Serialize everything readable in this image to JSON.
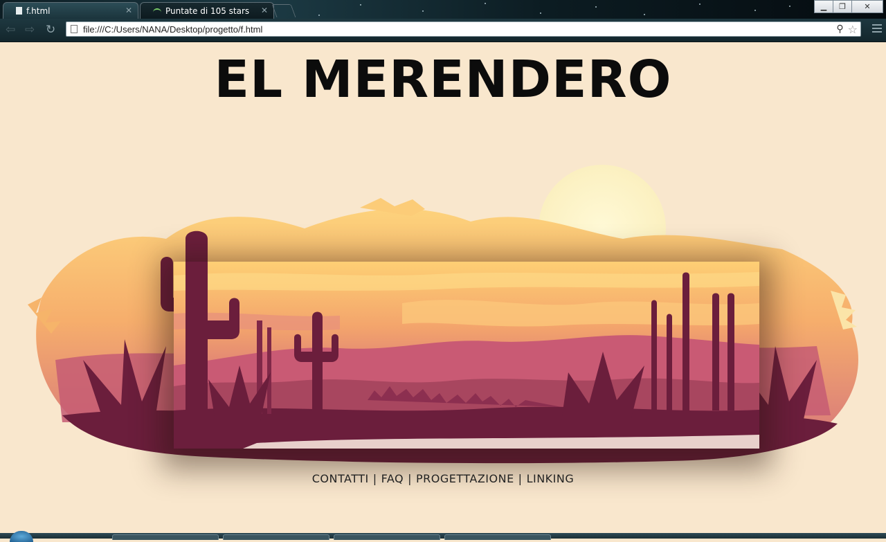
{
  "browser": {
    "tabs": [
      {
        "label": "f.html",
        "active": true
      },
      {
        "label": "Puntate di 105 stars",
        "active": false
      }
    ],
    "address": "file:///C:/Users/NANA/Desktop/progetto/f.html"
  },
  "page": {
    "title": "EL MERENDERO",
    "nav": [
      {
        "label": "CONTATTI"
      },
      {
        "label": "FAQ"
      },
      {
        "label": "PROGETTAZIONE"
      },
      {
        "label": "LINKING"
      }
    ],
    "separator": "|"
  },
  "colors": {
    "page_bg": "#f9e7cd",
    "sunset_yellow": "#fcd27a",
    "sunset_orange": "#f4a867",
    "sunset_pink": "#cf6a77",
    "desert_maroon": "#6b1e3c",
    "sun": "#fdf5c9"
  }
}
